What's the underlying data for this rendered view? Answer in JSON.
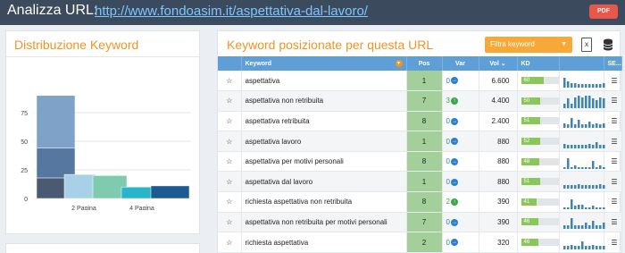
{
  "header": {
    "title": "Analizza URL:",
    "url": "http://www.fondoasim.it/aspettativa-dal-lavoro/",
    "pdf_label": "PDF"
  },
  "left_panel": {
    "title": "Distribuzione Keyword"
  },
  "chart_data": {
    "type": "bar",
    "y_ticks": [
      "75",
      "50",
      "25",
      "0"
    ],
    "x_tick_labels": [
      "2 Pagina",
      "4 Pagina"
    ],
    "ylim": [
      0,
      100
    ],
    "bars": [
      {
        "values": [
          18,
          26,
          46
        ],
        "colors": [
          "#4a5a72",
          "#5678a0",
          "#7fa3c8"
        ]
      },
      {
        "values": [
          21
        ],
        "colors": [
          "#a8d0e6"
        ]
      },
      {
        "values": [
          20
        ],
        "colors": [
          "#7fcbb0"
        ]
      },
      {
        "values": [
          10
        ],
        "colors": [
          "#27b5cc"
        ]
      },
      {
        "values": [
          11
        ],
        "colors": [
          "#1e5a92"
        ]
      }
    ]
  },
  "right_panel": {
    "title": "Keyword posizionate per questa URL",
    "filter_label": "Filtra keyword"
  },
  "table": {
    "headers": {
      "keyword": "Keyword",
      "pos": "Pos",
      "var": "Var",
      "vol": "Vol",
      "kd": "KD",
      "se": "SE..."
    },
    "rows": [
      {
        "keyword": "aspettativa",
        "pos": "1",
        "var": "0",
        "var_dir": "right",
        "vol": "6.600",
        "kd": "60",
        "kd_pct": 60,
        "trend": [
          6,
          4,
          3,
          3,
          2,
          2,
          2,
          2,
          2,
          2,
          2,
          3
        ]
      },
      {
        "keyword": "aspettativa non retribuita",
        "pos": "7",
        "var": "3",
        "var_dir": "up",
        "vol": "4.400",
        "kd": "50",
        "kd_pct": 50,
        "trend": [
          3,
          6,
          3,
          7,
          8,
          7,
          8,
          8,
          6,
          5,
          7,
          6
        ]
      },
      {
        "keyword": "aspettativa retribuita",
        "pos": "8",
        "var": "0",
        "var_dir": "right",
        "vol": "2.400",
        "kd": "51",
        "kd_pct": 51,
        "trend": [
          3,
          2,
          6,
          2,
          5,
          2,
          2,
          4,
          2,
          3,
          2,
          3
        ]
      },
      {
        "keyword": "aspettativa lavoro",
        "pos": "1",
        "var": "0",
        "var_dir": "right",
        "vol": "880",
        "kd": "52",
        "kd_pct": 52,
        "trend": [
          3,
          2,
          2,
          2,
          2,
          2,
          2,
          3,
          2,
          4,
          2,
          2
        ]
      },
      {
        "keyword": "aspettativa per motivi personali",
        "pos": "8",
        "var": "0",
        "var_dir": "right",
        "vol": "880",
        "kd": "48",
        "kd_pct": 48,
        "trend": [
          1,
          7,
          1,
          2,
          1,
          1,
          1,
          1,
          5,
          1,
          2,
          1
        ]
      },
      {
        "keyword": "aspettativa dal lavoro",
        "pos": "1",
        "var": "0",
        "var_dir": "right",
        "vol": "880",
        "kd": "51",
        "kd_pct": 51,
        "trend": [
          2,
          2,
          2,
          2,
          3,
          2,
          2,
          2,
          2,
          2,
          3,
          2
        ]
      },
      {
        "keyword": "richiesta aspettativa non retribuita",
        "pos": "8",
        "var": "2",
        "var_dir": "up",
        "vol": "390",
        "kd": "41",
        "kd_pct": 41,
        "trend": [
          1,
          1,
          6,
          2,
          3,
          3,
          1,
          1,
          2,
          1,
          1,
          1
        ]
      },
      {
        "keyword": "aspettativa non retribuita per motivi personali",
        "pos": "7",
        "var": "0",
        "var_dir": "right",
        "vol": "390",
        "kd": "46",
        "kd_pct": 46,
        "trend": [
          2,
          2,
          7,
          2,
          2,
          2,
          4,
          2,
          5,
          2,
          2,
          4
        ]
      },
      {
        "keyword": "richiesta aspettativa",
        "pos": "2",
        "var": "0",
        "var_dir": "right",
        "vol": "320",
        "kd": "46",
        "kd_pct": 46,
        "trend": [
          2,
          2,
          3,
          2,
          2,
          5,
          2,
          2,
          3,
          2,
          2,
          2
        ]
      }
    ]
  },
  "colors": {
    "accent_orange": "#f39324",
    "header_blue": "#5f9fd8",
    "pos_green": "#a3d09a",
    "kd_green": "#8bc65a",
    "trend_blue": "#3b82c6"
  }
}
